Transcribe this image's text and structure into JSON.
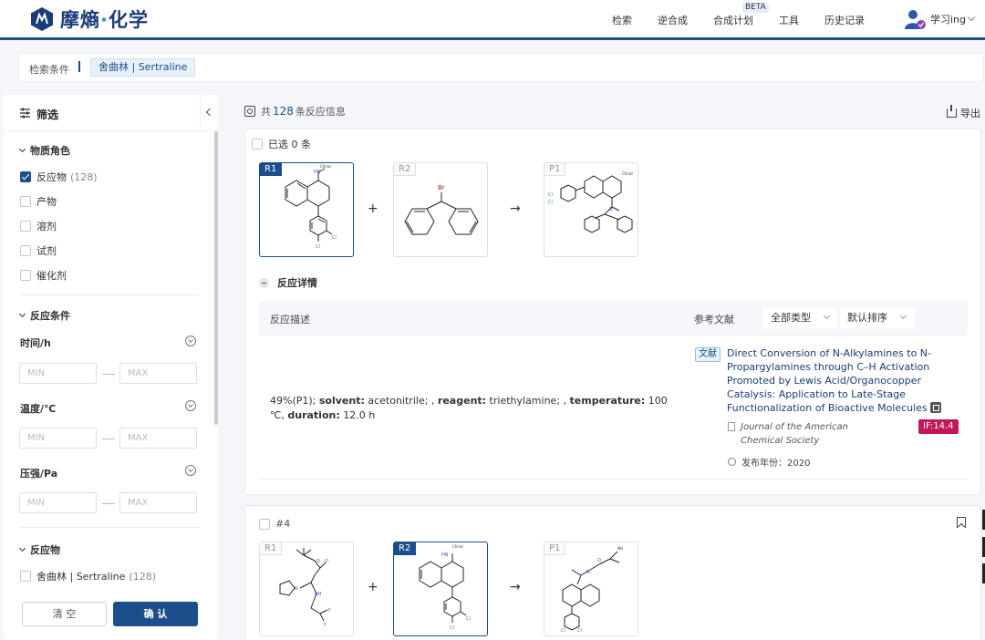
{
  "header": {
    "logo_text_a": "摩熵",
    "logo_text_dot": "·",
    "logo_text_b": "化学",
    "nav": [
      "检索",
      "逆合成",
      "合成计划",
      "工具",
      "历史记录"
    ],
    "beta_label": "BETA",
    "user_name": "学习ing"
  },
  "breadcrumb": {
    "label": "检索条件",
    "tag": "舍曲林 | Sertraline"
  },
  "sidebar": {
    "title": "筛选",
    "role_section": "物质角色",
    "roles": [
      {
        "label": "反应物",
        "count": "(128)",
        "checked": true
      },
      {
        "label": "产物",
        "count": "",
        "checked": false
      },
      {
        "label": "溶剂",
        "count": "",
        "checked": false
      },
      {
        "label": "试剂",
        "count": "",
        "checked": false
      },
      {
        "label": "催化剂",
        "count": "",
        "checked": false
      }
    ],
    "condition_section": "反应条件",
    "conditions": [
      {
        "label": "时间/h",
        "min": "MIN",
        "max": "MAX"
      },
      {
        "label": "温度/℃",
        "min": "MIN",
        "max": "MAX"
      },
      {
        "label": "压强/Pa",
        "min": "MIN",
        "max": "MAX"
      }
    ],
    "reactant_section": "反应物",
    "reactant_item": {
      "label": "舍曲林 | Sertraline",
      "count": "(128)"
    },
    "clear_label": "清 空",
    "confirm_label": "确 认"
  },
  "results": {
    "prefix": "共",
    "count": "128",
    "suffix": "条反应信息",
    "export_label": "导出",
    "select_all": "已选 0 条"
  },
  "reaction1": {
    "tags": [
      "R1",
      "R2",
      "P1"
    ],
    "plus": "+",
    "arrow": "→",
    "chiral": "Chiral",
    "detail_toggle": "反应详情",
    "col_desc": "反应描述",
    "col_ref": "参考文献",
    "type_select": "全部类型",
    "sort_select": "默认排序",
    "desc_yield": "49%(P1); ",
    "desc_solvent_k": "solvent:",
    "desc_solvent_v": " acetonitrile; , ",
    "desc_reagent_k": "reagent:",
    "desc_reagent_v": " triethylamine; , ",
    "desc_temp_k": "temperature:",
    "desc_temp_v": " 100 ℃, ",
    "desc_dur_k": "duration:",
    "desc_dur_v": " 12.0 h",
    "doc_badge": "文献",
    "doc_title": "Direct Conversion of N-Alkylamines to N-Propargylamines through C–H Activation Promoted by Lewis Acid/Organocopper Catalysis: Application to Late-Stage Functionalization of Bioactive Molecules",
    "journal": "Journal of the American Chemical Society",
    "impact_factor": "IF:14.4",
    "year_label": "发布年份：2020"
  },
  "reaction2": {
    "number": "#4",
    "tags": [
      "R1",
      "R2",
      "P1"
    ],
    "plus": "+",
    "arrow": "→",
    "chiral": "Chiral"
  }
}
